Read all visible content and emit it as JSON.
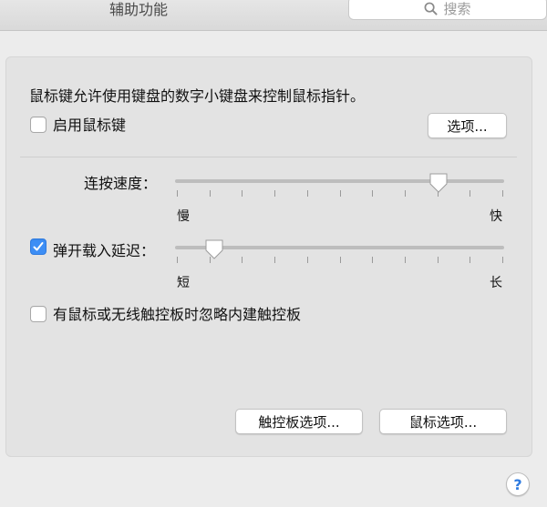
{
  "window": {
    "title": "辅助功能"
  },
  "search": {
    "placeholder": "搜索",
    "icon": "magnifier-icon"
  },
  "mouse_keys": {
    "description": "鼠标键允许使用键盘的数字小键盘来控制鼠标指针。",
    "enable_label": "启用鼠标键",
    "enable_checked": false,
    "options_button": "选项..."
  },
  "repeat_speed": {
    "label": "连按速度：",
    "min_label": "慢",
    "max_label": "快",
    "value": 0.8
  },
  "initial_delay": {
    "label": "弹开载入延迟：",
    "checked": true,
    "min_label": "短",
    "max_label": "长",
    "value": 0.12
  },
  "ignore_builtin": {
    "label": "有鼠标或无线触控板时忽略内建触控板",
    "checked": false
  },
  "buttons": {
    "trackpad_options": "触控板选项...",
    "mouse_options": "鼠标选项..."
  },
  "help": {
    "label": "?"
  },
  "colors": {
    "accent": "#3d8ef5",
    "background": "#ececec"
  }
}
